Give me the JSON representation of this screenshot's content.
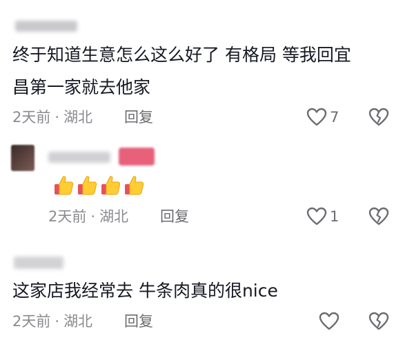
{
  "comments": [
    {
      "text_line1": "终于知道生意怎么这么好了 有格局 等我回宜",
      "text_line2": "昌第一家就去他家",
      "time": "2天前",
      "location": "湖北",
      "reply_label": "回复",
      "like_count": "7"
    },
    {
      "emoji": "👍👍👍👍",
      "time": "2天前",
      "location": "湖北",
      "reply_label": "回复",
      "like_count": "1"
    },
    {
      "text_line1": "这家店我经常去 牛条肉真的很nice",
      "time": "2天前",
      "location": "湖北",
      "reply_label": "回复",
      "like_count": ""
    }
  ],
  "separator": "·",
  "icons": {
    "like": "heart-outline-icon",
    "dislike": "broken-heart-icon"
  },
  "colors": {
    "text": "#161823",
    "meta": "#8a8a8f",
    "icon": "#6b6b70"
  }
}
